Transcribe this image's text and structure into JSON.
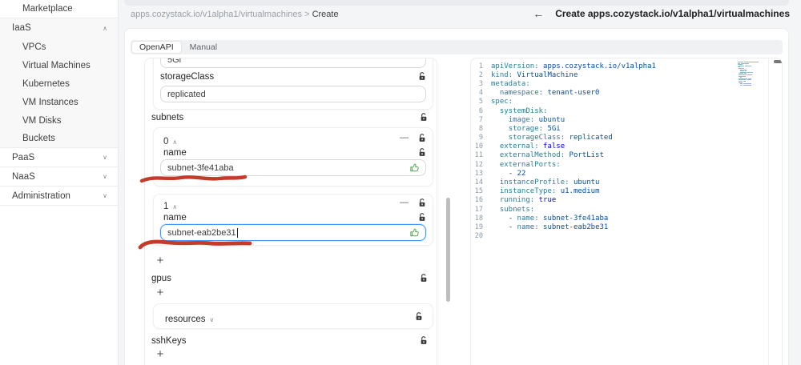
{
  "colors": {
    "accent_focus": "#4096ff",
    "annotation_red": "#c53b2a",
    "yaml_key": "#267f99",
    "yaml_string": "#0451a5",
    "yaml_bool": "#0000ff"
  },
  "sidebar": {
    "items": [
      {
        "label": "Marketplace",
        "level": "child",
        "chevron": "",
        "group": false,
        "divider": true
      },
      {
        "label": "IaaS",
        "level": "top",
        "chevron": "up",
        "group": true,
        "divider": false
      },
      {
        "label": "VPCs",
        "level": "child",
        "chevron": "",
        "group": true,
        "divider": false
      },
      {
        "label": "Virtual Machines",
        "level": "child",
        "chevron": "",
        "group": true,
        "divider": false
      },
      {
        "label": "Kubernetes",
        "level": "child",
        "chevron": "",
        "group": true,
        "divider": false
      },
      {
        "label": "VM Instances",
        "level": "child",
        "chevron": "",
        "group": true,
        "divider": false
      },
      {
        "label": "VM Disks",
        "level": "child",
        "chevron": "",
        "group": true,
        "divider": false
      },
      {
        "label": "Buckets",
        "level": "child",
        "chevron": "",
        "group": true,
        "divider": true
      },
      {
        "label": "PaaS",
        "level": "top",
        "chevron": "down",
        "group": false,
        "divider": true
      },
      {
        "label": "NaaS",
        "level": "top",
        "chevron": "down",
        "group": false,
        "divider": true
      },
      {
        "label": "Administration",
        "level": "top",
        "chevron": "down",
        "group": false,
        "divider": true
      }
    ],
    "chevron_up": "∧",
    "chevron_down": "∨"
  },
  "breadcrumb": {
    "path": "apps.cozystack.io/v1alpha1/virtualmachines",
    "separator": ">",
    "current": "Create"
  },
  "header": {
    "back_glyph": "←",
    "title": "Create apps.cozystack.io/v1alpha1/virtualmachines"
  },
  "tabs": [
    {
      "label": "OpenAPI",
      "active": true
    },
    {
      "label": "Manual",
      "active": false
    }
  ],
  "form": {
    "partial_input_value": "5Gi",
    "storage_class": {
      "label": "storageClass",
      "value": "replicated"
    },
    "subnets": {
      "label": "subnets",
      "items": [
        {
          "index": "0",
          "name_label": "name",
          "value": "subnet-3fe41aba",
          "focused": false
        },
        {
          "index": "1",
          "name_label": "name",
          "value": "subnet-eab2be31",
          "focused": true
        }
      ]
    },
    "add_label": "+",
    "remove_glyph": "—",
    "collapse_glyph": "∧",
    "expand_glyph": "∨",
    "gpus_label": "gpus",
    "resources_label": "resources",
    "sshkeys_label": "sshKeys"
  },
  "editor": {
    "lines": [
      {
        "n": 1,
        "indent": 0,
        "dash": false,
        "key": "apiVersion",
        "value": "apps.cozystack.io/v1alpha1",
        "vtype": "str"
      },
      {
        "n": 2,
        "indent": 0,
        "dash": false,
        "key": "kind",
        "value": "VirtualMachine",
        "vtype": "str"
      },
      {
        "n": 3,
        "indent": 0,
        "dash": false,
        "key": "metadata",
        "value": "",
        "vtype": ""
      },
      {
        "n": 4,
        "indent": 1,
        "dash": false,
        "key": "namespace",
        "value": "tenant-user0",
        "vtype": "str"
      },
      {
        "n": 5,
        "indent": 0,
        "dash": false,
        "key": "spec",
        "value": "",
        "vtype": ""
      },
      {
        "n": 6,
        "indent": 1,
        "dash": false,
        "key": "systemDisk",
        "value": "",
        "vtype": ""
      },
      {
        "n": 7,
        "indent": 2,
        "dash": false,
        "key": "image",
        "value": "ubuntu",
        "vtype": "str"
      },
      {
        "n": 8,
        "indent": 2,
        "dash": false,
        "key": "storage",
        "value": "5Gi",
        "vtype": "str"
      },
      {
        "n": 9,
        "indent": 2,
        "dash": false,
        "key": "storageClass",
        "value": "replicated",
        "vtype": "str"
      },
      {
        "n": 10,
        "indent": 1,
        "dash": false,
        "key": "external",
        "value": "false",
        "vtype": "bool"
      },
      {
        "n": 11,
        "indent": 1,
        "dash": false,
        "key": "externalMethod",
        "value": "PortList",
        "vtype": "str"
      },
      {
        "n": 12,
        "indent": 1,
        "dash": false,
        "key": "externalPorts",
        "value": "",
        "vtype": ""
      },
      {
        "n": 13,
        "indent": 2,
        "dash": true,
        "key": "",
        "value": "22",
        "vtype": "num"
      },
      {
        "n": 14,
        "indent": 1,
        "dash": false,
        "key": "instanceProfile",
        "value": "ubuntu",
        "vtype": "str"
      },
      {
        "n": 15,
        "indent": 1,
        "dash": false,
        "key": "instanceType",
        "value": "u1.medium",
        "vtype": "str"
      },
      {
        "n": 16,
        "indent": 1,
        "dash": false,
        "key": "running",
        "value": "true",
        "vtype": "bool"
      },
      {
        "n": 17,
        "indent": 1,
        "dash": false,
        "key": "subnets",
        "value": "",
        "vtype": ""
      },
      {
        "n": 18,
        "indent": 2,
        "dash": true,
        "key": "name",
        "value": "subnet-3fe41aba",
        "vtype": "str"
      },
      {
        "n": 19,
        "indent": 2,
        "dash": true,
        "key": "name",
        "value": "subnet-eab2be31",
        "vtype": "str"
      },
      {
        "n": 20,
        "indent": 0,
        "dash": false,
        "key": "",
        "value": "",
        "vtype": ""
      }
    ]
  }
}
